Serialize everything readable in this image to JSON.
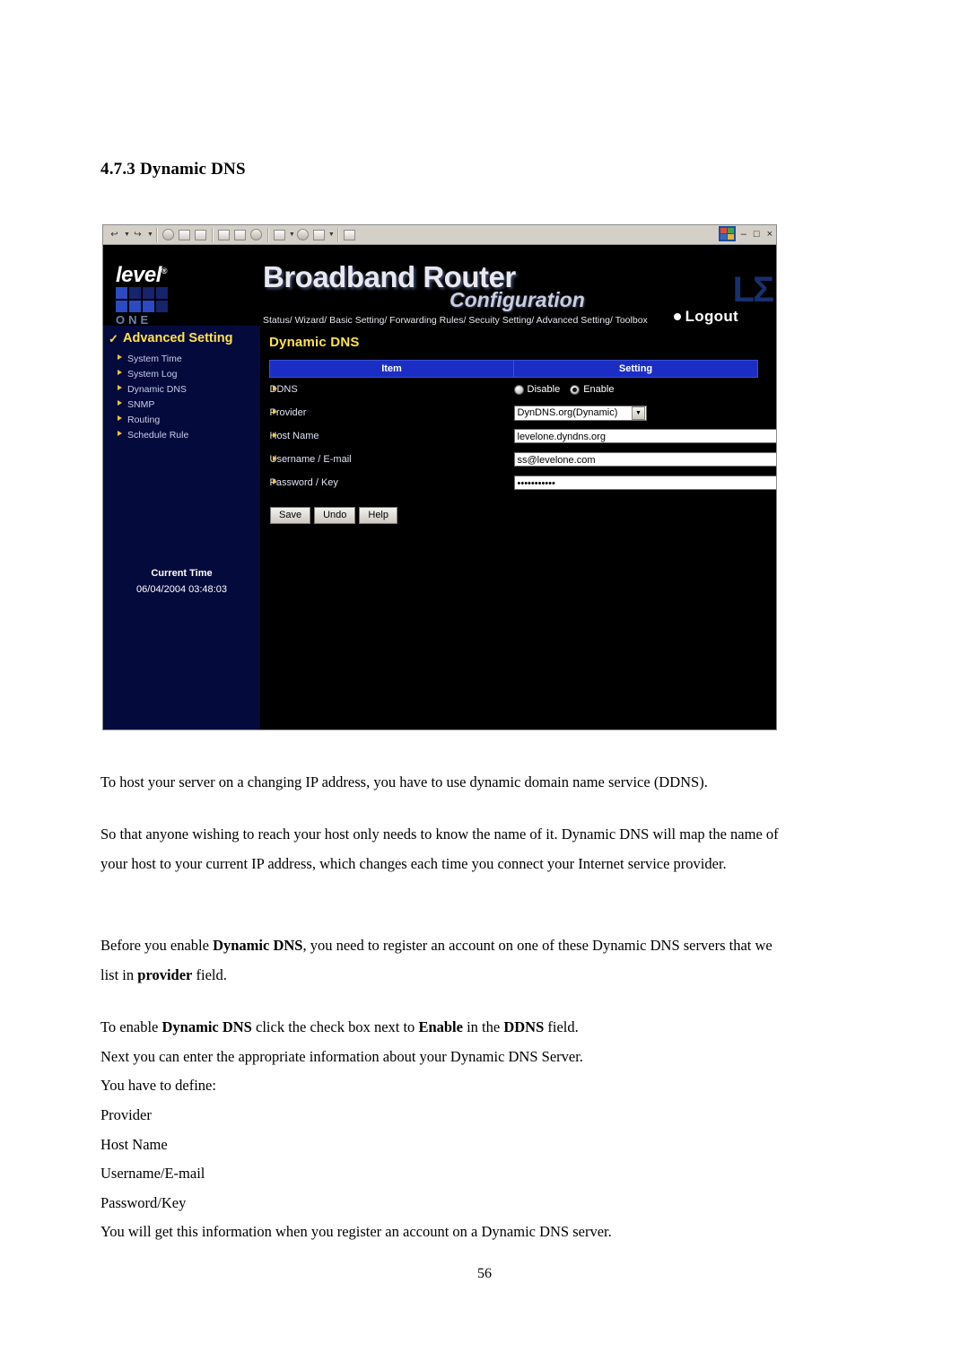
{
  "document": {
    "heading": "4.7.3 Dynamic DNS",
    "page_number": "56",
    "paragraphs": [
      "To host your server on a changing IP address, you have to use dynamic domain name service (DDNS).",
      "So that anyone wishing to reach your host only needs to know the name of it. Dynamic DNS will map the name of your host to your current IP address, which changes each time you connect your Internet service provider.",
      "Before you enable Dynamic DNS, you need to register an account on one of these Dynamic DNS servers that we list in provider field.",
      "To enable Dynamic DNS click the check box next to Enable in the DDNS field.",
      "Next you can enter the appropriate information about your Dynamic DNS Server.",
      "You have to define:",
      "Provider",
      "Host Name",
      "Username/E-mail",
      "Password/Key",
      "You will get this information when you register an account on a Dynamic DNS server."
    ]
  },
  "screenshot": {
    "toolbar": {
      "back_label": "↩",
      "forward_label": "↪",
      "window_minimize": "–",
      "window_restore": "□",
      "window_close": "×"
    },
    "banner": {
      "brand": "level",
      "brand_sup": "®",
      "brand_one": "ONE",
      "title": "Broadband Router",
      "subtitle": "Configuration",
      "right_mark": "LΣ",
      "nav": "Status/ Wizard/ Basic Setting/ Forwarding Rules/ Secuity Setting/ Advanced Setting/ Toolbox",
      "logout": "Logout"
    },
    "sidebar": {
      "title": "Advanced Setting",
      "items": [
        "System Time",
        "System Log",
        "Dynamic DNS",
        "SNMP",
        "Routing",
        "Schedule Rule"
      ],
      "current_time_label": "Current Time",
      "current_time_value": "06/04/2004 03:48:03"
    },
    "content": {
      "title": "Dynamic DNS",
      "columns": [
        "Item",
        "Setting"
      ],
      "rows": [
        {
          "item": "DDNS",
          "type": "radio",
          "options": [
            "Disable",
            "Enable"
          ],
          "selected": "Enable"
        },
        {
          "item": "Provider",
          "type": "select",
          "value": "DynDNS.org(Dynamic)"
        },
        {
          "item": "Host Name",
          "type": "text",
          "value": "levelone.dyndns.org"
        },
        {
          "item": "Username / E-mail",
          "type": "text",
          "value": "ss@levelone.com"
        },
        {
          "item": "Password / Key",
          "type": "password",
          "value": "•••••••••••"
        }
      ],
      "buttons": [
        "Save",
        "Undo",
        "Help"
      ]
    }
  }
}
